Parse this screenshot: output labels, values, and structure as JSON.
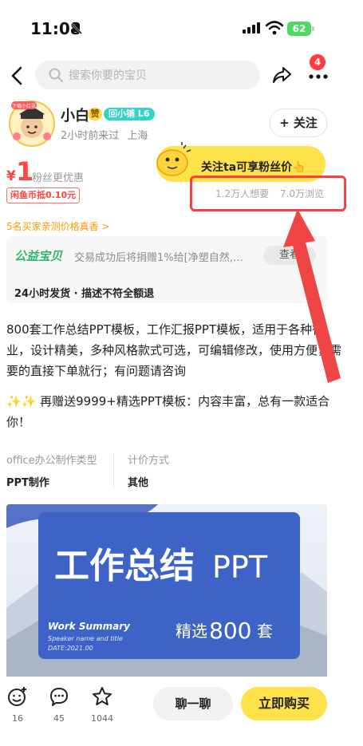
{
  "status_bar": {
    "time": "11:08",
    "battery": "62"
  },
  "nav": {
    "search_placeholder": "搜索你要的宝贝",
    "notification_count": "4"
  },
  "seller": {
    "name": "小白",
    "praise_badge": "赞",
    "level_badge": "回小铺 L6",
    "last_seen": "2小时前来过",
    "location": "上海",
    "follow_label": "+ 关注",
    "avatar_tag": "下载小红花"
  },
  "price": {
    "currency": "¥",
    "value": "1",
    "fan_note": "粉丝更优惠",
    "coupon": "闲鱼币抵0.10元"
  },
  "fan_bubble": {
    "text": "关注ta可享粉丝价👆"
  },
  "stats": {
    "wants": "1.2万人想要",
    "views": "7.0万浏览"
  },
  "verify_line": "5名买家亲测价格真香 >",
  "charity": {
    "label": "公益宝贝",
    "text": "交易成功后将捐赠1%给[净塑自然,…",
    "view_label": "查看"
  },
  "guarantee": "24小时发货 · 描述不符全额退",
  "description": {
    "main": "800套工作总结PPT模板，工作汇报PPT模板，适用于各种行业，设计精美，多种风格款式可选，可编辑修改，使用方便，需要的直接下单就行；有问题请咨询",
    "extra": "✨✨ 再赠送9999+精选PPT模板：内容丰富，总有一款适合你！"
  },
  "attributes": [
    {
      "label": "office办公制作类型",
      "value": "PPT制作"
    },
    {
      "label": "计价方式",
      "value": "其他"
    }
  ],
  "product_image": {
    "title": "工作总结",
    "title_suffix": "PPT",
    "subtitle": "Work Summary",
    "speaker": "Speaker name and title",
    "date": "DATE:2021.00",
    "selection_prefix": "精选",
    "selection_num": "800",
    "selection_suffix": "套"
  },
  "bottom_bar": {
    "like_count": "16",
    "comment_count": "45",
    "favorite_count": "1044",
    "chat_label": "聊一聊",
    "buy_label": "立即购买"
  },
  "colors": {
    "accent_yellow": "#ffe14a",
    "price_red": "#ff4545",
    "charity_green": "#2fb66c",
    "highlight_red": "#f04545",
    "orange": "#ff9800"
  }
}
